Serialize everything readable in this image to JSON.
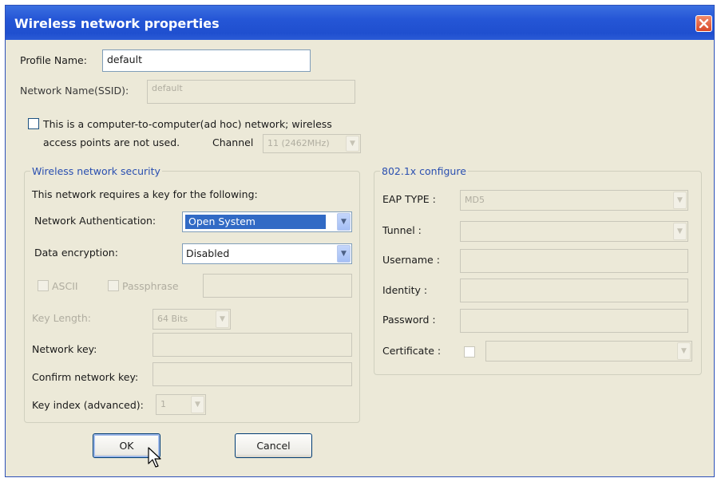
{
  "window": {
    "title": "Wireless network properties"
  },
  "profile": {
    "label": "Profile Name:",
    "value": "default"
  },
  "ssid": {
    "label": "Network Name(SSID):",
    "value": "default"
  },
  "adhoc": {
    "line1": "This is a computer-to-computer(ad hoc) network; wireless",
    "line2": "access points are not used.",
    "channel_label": "Channel",
    "channel_value": "11 (2462MHz)"
  },
  "security": {
    "legend": "Wireless network security",
    "intro": "This network requires a key for the following:",
    "auth_label": "Network Authentication:",
    "auth_value": "Open System",
    "enc_label": "Data encryption:",
    "enc_value": "Disabled",
    "ascii_label": "ASCII",
    "passphrase_label": "Passphrase",
    "keylen_label": "Key Length:",
    "keylen_value": "64 Bits",
    "netkey_label": "Network key:",
    "confirm_label": "Confirm network key:",
    "keyindex_label": "Key index (advanced):",
    "keyindex_value": "1"
  },
  "dot1x": {
    "legend": "802.1x configure",
    "eap_label": "EAP TYPE :",
    "eap_value": "MD5",
    "tunnel_label": "Tunnel :",
    "username_label": "Username :",
    "identity_label": "Identity :",
    "password_label": "Password :",
    "certificate_label": "Certificate :"
  },
  "buttons": {
    "ok": "OK",
    "cancel": "Cancel"
  },
  "icons": {
    "close": "close-icon",
    "dropdown": "chevron-down-icon",
    "cursor": "mouse-pointer-icon"
  }
}
